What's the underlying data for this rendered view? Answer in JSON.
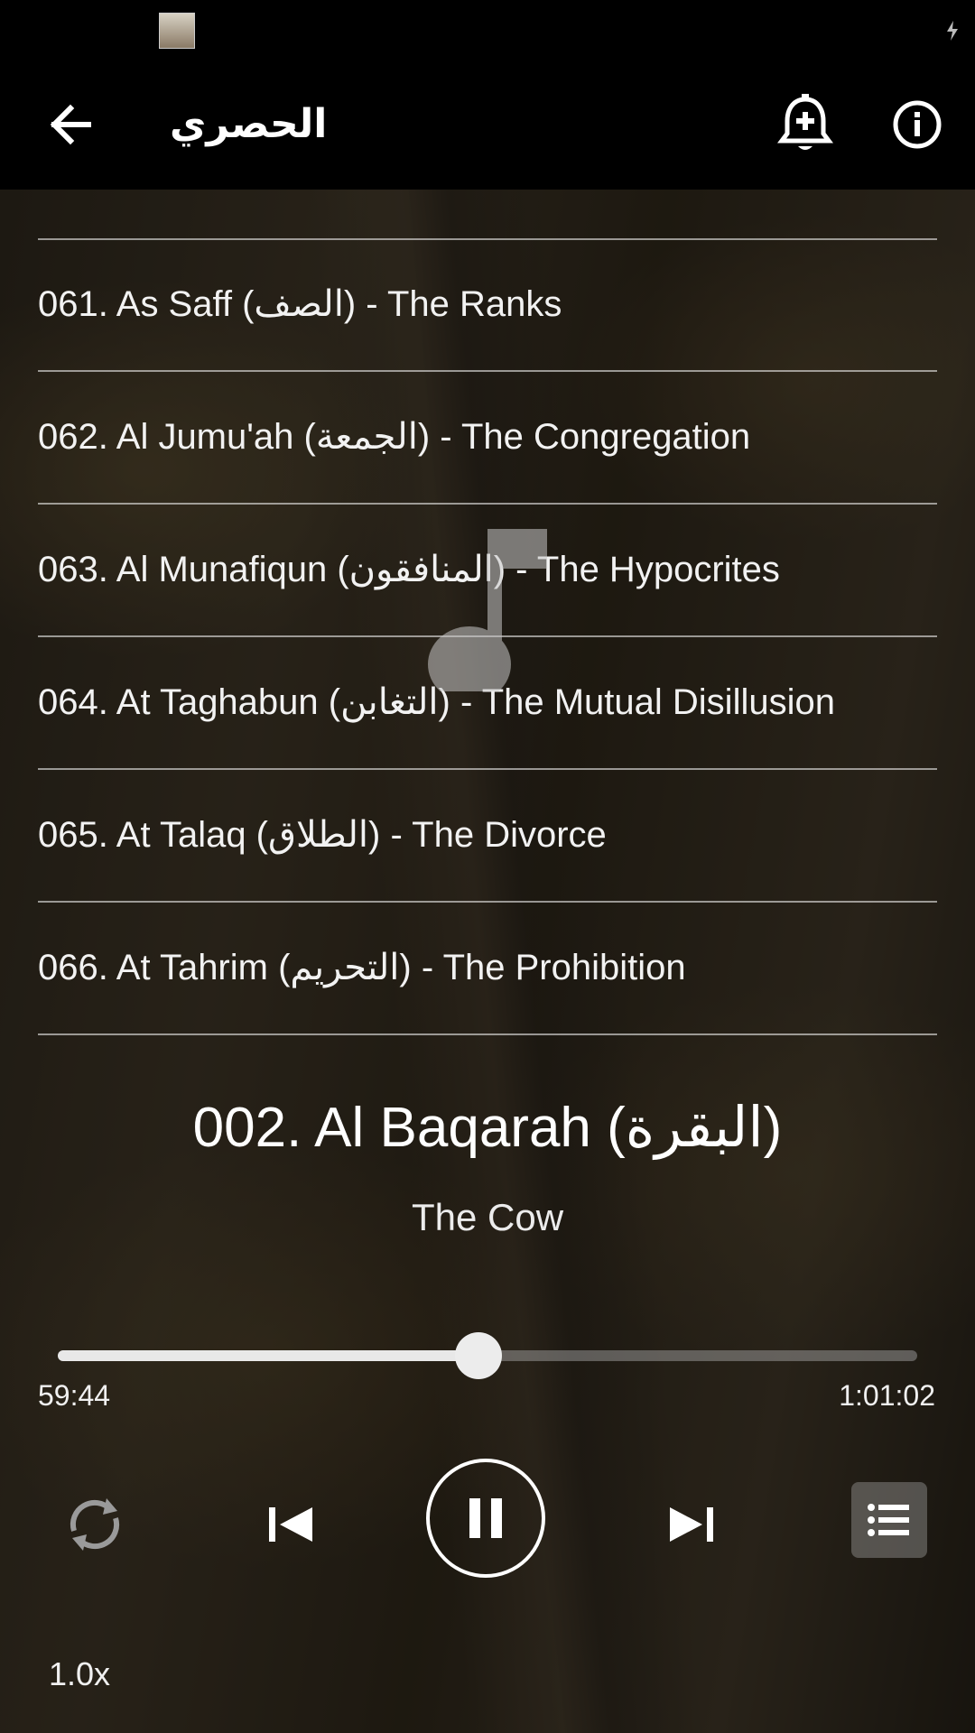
{
  "app": {
    "title": "الحصري"
  },
  "header": {
    "back_icon": "arrow-left-icon",
    "alarm_icon": "alarm-add-icon",
    "info_icon": "info-icon"
  },
  "surah_list": [
    {
      "label": "061. As Saff (الصف) - The Ranks"
    },
    {
      "label": "062. Al Jumu'ah (الجمعة) - The Congregation"
    },
    {
      "label": "063. Al Munafiqun (المنافقون) - The Hypocrites"
    },
    {
      "label": "064. At Taghabun (التغابن) - The Mutual Disillusion"
    },
    {
      "label": "065. At Talaq (الطلاق) - The Divorce"
    },
    {
      "label": "066. At Tahrim (التحريم) - The Prohibition"
    }
  ],
  "now_playing": {
    "title": "002. Al Baqarah (البقرة)",
    "subtitle": "The Cow",
    "elapsed": "59:44",
    "total": "1:01:02",
    "progress_fraction": 0.49
  },
  "controls": {
    "repeat_icon": "repeat-icon",
    "prev_icon": "skip-previous-icon",
    "play_icon": "pause-icon",
    "next_icon": "skip-next-icon",
    "playlist_icon": "playlist-icon",
    "speed": "1.0x"
  },
  "colors": {
    "appbar": "#000000",
    "text": "#ffffff",
    "divider": "#bfbfbf"
  }
}
